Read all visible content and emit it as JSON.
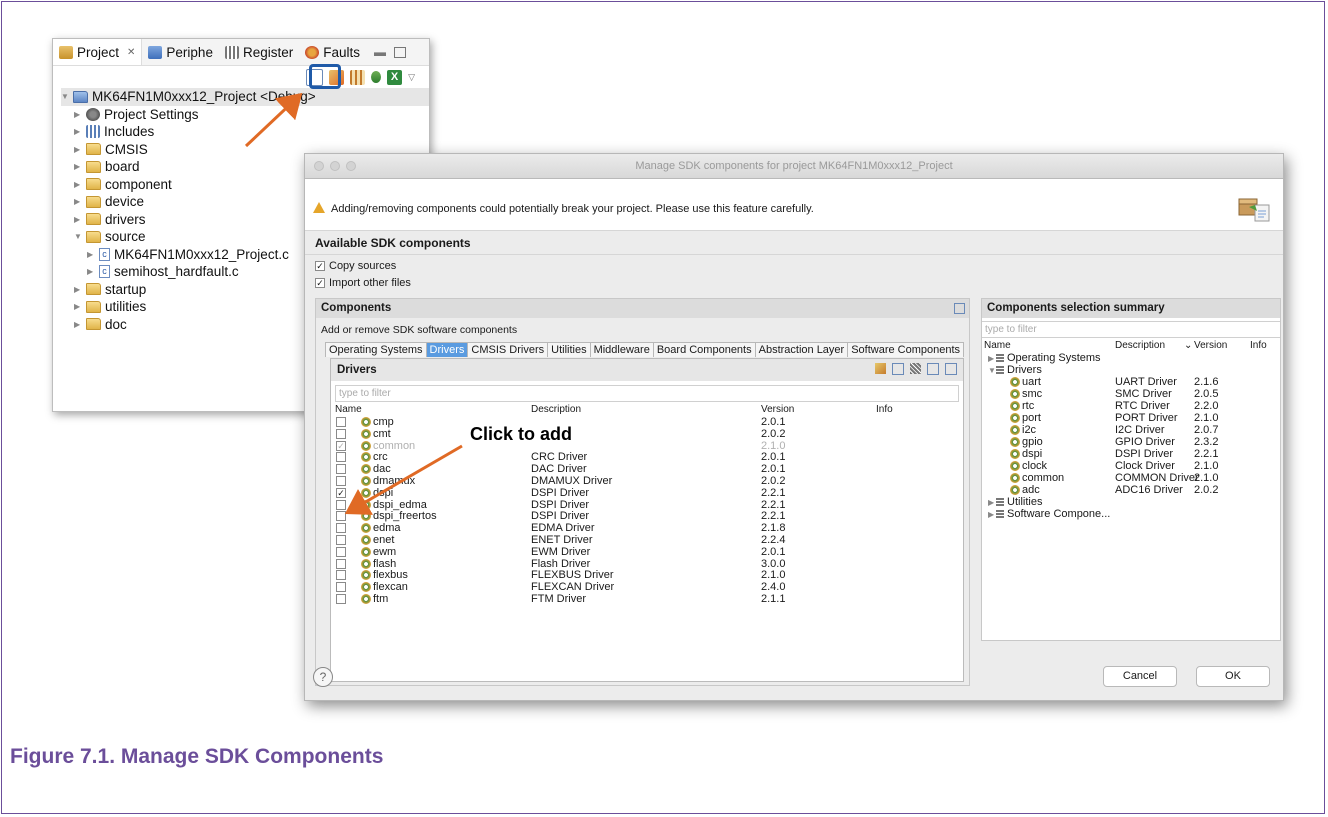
{
  "project_view": {
    "tabs": [
      {
        "label": "Project",
        "close": "✕"
      },
      {
        "label": "Periphe"
      },
      {
        "label": "Register"
      },
      {
        "label": "Faults"
      }
    ],
    "tree": [
      {
        "label": "MK64FN1M0xxx12_Project <Debug>",
        "level": 0
      },
      {
        "label": "Project Settings",
        "level": 1
      },
      {
        "label": "Includes",
        "level": 1
      },
      {
        "label": "CMSIS",
        "level": 1
      },
      {
        "label": "board",
        "level": 1
      },
      {
        "label": "component",
        "level": 1
      },
      {
        "label": "device",
        "level": 1
      },
      {
        "label": "drivers",
        "level": 1
      },
      {
        "label": "source",
        "level": 1
      },
      {
        "label": "MK64FN1M0xxx12_Project.c",
        "level": 2
      },
      {
        "label": "semihost_hardfault.c",
        "level": 2
      },
      {
        "label": "startup",
        "level": 1
      },
      {
        "label": "utilities",
        "level": 1
      },
      {
        "label": "doc",
        "level": 1
      }
    ]
  },
  "dialog": {
    "title": "Manage SDK components for project MK64FN1M0xxx12_Project",
    "warning": "Adding/removing components could potentially break your project. Please use this feature carefully.",
    "available_title": "Available SDK components",
    "copy_sources": "Copy sources",
    "import_other": "Import other files",
    "components_title": "Components",
    "components_subtitle": "Add or remove SDK software components",
    "tabs": [
      "Operating Systems",
      "Drivers",
      "CMSIS Drivers",
      "Utilities",
      "Middleware",
      "Board Components",
      "Abstraction Layer",
      "Software Components"
    ],
    "drivers_title": "Drivers",
    "filter_placeholder": "type to filter",
    "col_name": "Name",
    "col_desc": "Description",
    "col_version": "Version",
    "col_info": "Info",
    "drivers": [
      {
        "name": "cmp",
        "desc": "",
        "version": "2.0.1",
        "checked": false,
        "grey": false
      },
      {
        "name": "cmt",
        "desc": "",
        "version": "2.0.2",
        "checked": false,
        "grey": false
      },
      {
        "name": "common",
        "desc": "",
        "version": "2.1.0",
        "checked": true,
        "grey": true
      },
      {
        "name": "crc",
        "desc": "CRC Driver",
        "version": "2.0.1",
        "checked": false,
        "grey": false
      },
      {
        "name": "dac",
        "desc": "DAC Driver",
        "version": "2.0.1",
        "checked": false,
        "grey": false
      },
      {
        "name": "dmamux",
        "desc": "DMAMUX Driver",
        "version": "2.0.2",
        "checked": false,
        "grey": false
      },
      {
        "name": "dspi",
        "desc": "DSPI Driver",
        "version": "2.2.1",
        "checked": true,
        "grey": false
      },
      {
        "name": "dspi_edma",
        "desc": "DSPI Driver",
        "version": "2.2.1",
        "checked": false,
        "grey": false
      },
      {
        "name": "dspi_freertos",
        "desc": "DSPI Driver",
        "version": "2.2.1",
        "checked": false,
        "grey": false
      },
      {
        "name": "edma",
        "desc": "EDMA Driver",
        "version": "2.1.8",
        "checked": false,
        "grey": false
      },
      {
        "name": "enet",
        "desc": "ENET Driver",
        "version": "2.2.4",
        "checked": false,
        "grey": false
      },
      {
        "name": "ewm",
        "desc": "EWM Driver",
        "version": "2.0.1",
        "checked": false,
        "grey": false
      },
      {
        "name": "flash",
        "desc": "Flash Driver",
        "version": "3.0.0",
        "checked": false,
        "grey": false
      },
      {
        "name": "flexbus",
        "desc": "FLEXBUS Driver",
        "version": "2.1.0",
        "checked": false,
        "grey": false
      },
      {
        "name": "flexcan",
        "desc": "FLEXCAN Driver",
        "version": "2.4.0",
        "checked": false,
        "grey": false
      },
      {
        "name": "ftm",
        "desc": "FTM Driver",
        "version": "2.1.1",
        "checked": false,
        "grey": false
      }
    ],
    "summary_title": "Components selection summary",
    "summary_filter": "type to filter",
    "summary_cols": {
      "name": "Name",
      "desc": "Description",
      "version": "Version",
      "info": "Info"
    },
    "summary_groups": {
      "os": "Operating Systems",
      "drivers": "Drivers",
      "utilities": "Utilities",
      "software": "Software Compone..."
    },
    "summary_drivers": [
      {
        "name": "uart",
        "desc": "UART Driver",
        "version": "2.1.6"
      },
      {
        "name": "smc",
        "desc": "SMC Driver",
        "version": "2.0.5"
      },
      {
        "name": "rtc",
        "desc": "RTC Driver",
        "version": "2.2.0"
      },
      {
        "name": "port",
        "desc": "PORT Driver",
        "version": "2.1.0"
      },
      {
        "name": "i2c",
        "desc": "I2C Driver",
        "version": "2.0.7"
      },
      {
        "name": "gpio",
        "desc": "GPIO Driver",
        "version": "2.3.2"
      },
      {
        "name": "dspi",
        "desc": "DSPI Driver",
        "version": "2.2.1"
      },
      {
        "name": "clock",
        "desc": "Clock Driver",
        "version": "2.1.0"
      },
      {
        "name": "common",
        "desc": "COMMON Driver",
        "version": "2.1.0"
      },
      {
        "name": "adc",
        "desc": "ADC16 Driver",
        "version": "2.0.2"
      }
    ],
    "cancel": "Cancel",
    "ok": "OK",
    "help": "?"
  },
  "annotation": "Click to add",
  "caption": "Figure 7.1. Manage SDK Components",
  "colors": {
    "caption": "#6b4e9a",
    "arrow": "#e06a25",
    "highlight": "#1f5aa8",
    "active_tab": "#5a9be0"
  }
}
